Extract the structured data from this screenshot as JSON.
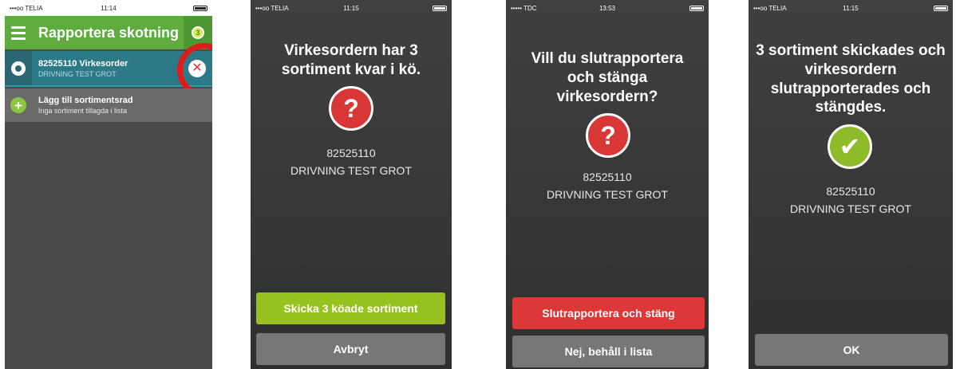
{
  "phone1": {
    "status": {
      "carrier": "•••oo TELIA",
      "time": "11:14"
    },
    "appbar": {
      "title": "Rapportera skotning",
      "badge": "3"
    },
    "order_row": {
      "title": "82525110 Virkesorder",
      "subtitle": "DRIVNING TEST GROT"
    },
    "add_row": {
      "title": "Lägg till sortimentsrad",
      "subtitle": "Inga sortiment tillagda i lista"
    }
  },
  "phone2": {
    "status": {
      "carrier": "•••oo TELIA",
      "time": "11:15"
    },
    "message": "Virkesordern har 3 sortiment kvar i kö.",
    "icon": "?",
    "order_number": "82525110",
    "order_name": "DRIVNING TEST GROT",
    "primary_button": "Skicka 3 köade sortiment",
    "secondary_button": "Avbryt"
  },
  "phone3": {
    "status": {
      "carrier": "••••• TDC",
      "time": "13:53"
    },
    "message": "Vill du slutrapportera och stänga virkesordern?",
    "icon": "?",
    "order_number": "82525110",
    "order_name": "DRIVNING TEST GROT",
    "primary_button": "Slutrapportera och stäng",
    "secondary_button": "Nej, behåll i lista"
  },
  "phone4": {
    "status": {
      "carrier": "•••oo TELIA",
      "time": "11:15"
    },
    "message": "3 sortiment skickades och virkesordern slutrapporterades och stängdes.",
    "icon": "✔",
    "order_number": "82525110",
    "order_name": "DRIVNING TEST GROT",
    "button": "OK"
  },
  "colors": {
    "app_green": "#5fac3e",
    "selected_teal": "#2c7a88",
    "alert_red": "#d93636",
    "success_green": "#8dbb2a",
    "button_green": "#97c11f",
    "button_red": "#dc3838",
    "button_gray": "#777777",
    "highlight_ring": "#e01b1b"
  }
}
